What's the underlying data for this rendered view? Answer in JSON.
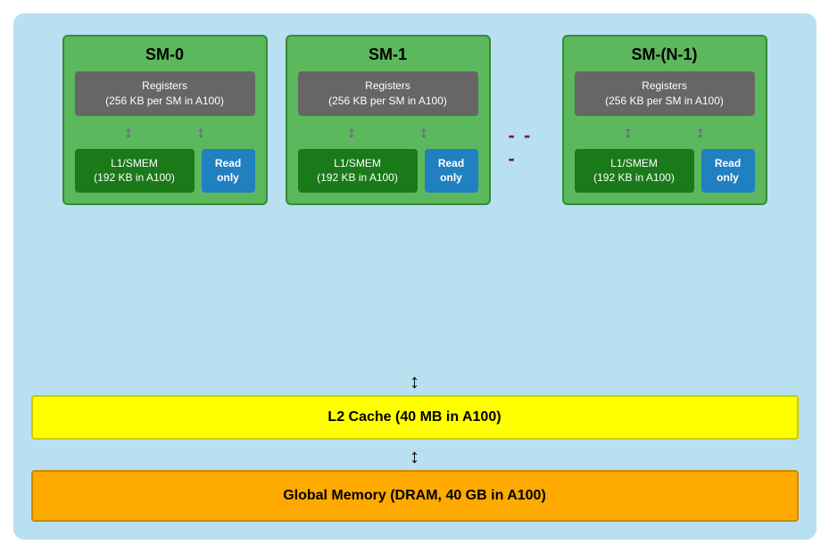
{
  "sm_blocks": [
    {
      "id": "sm0",
      "title": "SM-0",
      "registers_label": "Registers",
      "registers_detail": "(256 KB per SM in A100)",
      "l1_label": "L1/SMEM",
      "l1_detail": "(192 KB in A100)",
      "readonly_label": "Read only"
    },
    {
      "id": "sm1",
      "title": "SM-1",
      "registers_label": "Registers",
      "registers_detail": "(256 KB per SM in A100)",
      "l1_label": "L1/SMEM",
      "l1_detail": "(192 KB in A100)",
      "readonly_label": "Read only"
    },
    {
      "id": "smN1",
      "title": "SM-(N-1)",
      "registers_label": "Registers",
      "registers_detail": "(256 KB per SM in A100)",
      "l1_label": "L1/SMEM",
      "l1_detail": "(192 KB in A100)",
      "readonly_label": "Read only"
    }
  ],
  "dots": "- - -",
  "l2_label": "L2 Cache (40 MB in A100)",
  "global_label": "Global Memory (DRAM, 40 GB in A100)"
}
